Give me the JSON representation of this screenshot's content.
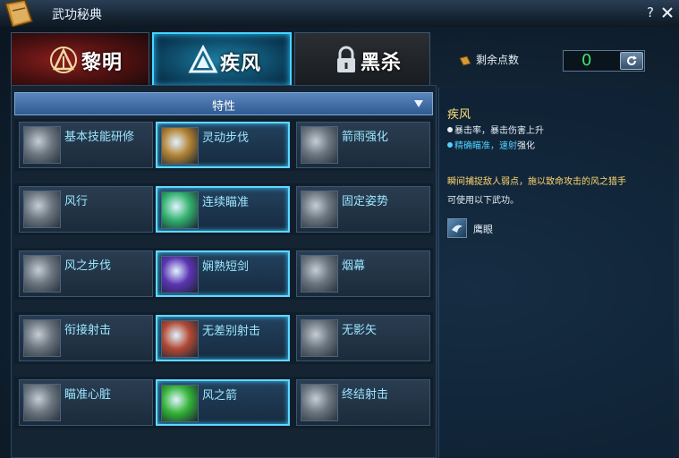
{
  "window": {
    "title": "武功秘典",
    "help_label": "?"
  },
  "tabs": [
    {
      "label": "黎明",
      "state": "inactive"
    },
    {
      "label": "疾风",
      "state": "active"
    },
    {
      "label": "黑杀",
      "state": "locked"
    }
  ],
  "points": {
    "label": "剩余点数",
    "value": "0"
  },
  "filter": {
    "selected": "特性"
  },
  "skills": [
    [
      {
        "name": "基本技能研修",
        "selected": false
      },
      {
        "name": "灵动步伐",
        "selected": true
      },
      {
        "name": "箭雨强化",
        "selected": false
      }
    ],
    [
      {
        "name": "风行",
        "selected": false
      },
      {
        "name": "连续瞄准",
        "selected": true
      },
      {
        "name": "固定姿势",
        "selected": false
      }
    ],
    [
      {
        "name": "风之步伐",
        "selected": false
      },
      {
        "name": "娴熟短剑",
        "selected": true
      },
      {
        "name": "烟幕",
        "selected": false
      }
    ],
    [
      {
        "name": "衔接射击",
        "selected": false
      },
      {
        "name": "无差别射击",
        "selected": true
      },
      {
        "name": "无影矢",
        "selected": false
      }
    ],
    [
      {
        "name": "瞄准心脏",
        "selected": false
      },
      {
        "name": "风之箭",
        "selected": true
      },
      {
        "name": "终结射击",
        "selected": false
      }
    ]
  ],
  "detail": {
    "title": "疾风",
    "line1": "暴击率，暴击伤害上升",
    "line2_a": "精确瞄准，速射",
    "line2_b": "强化",
    "description": "瞬间捕捉敌人弱点，施以致命攻击的风之猎手",
    "usable_text": "可使用以下武功。",
    "usable_skill": "鹰眼"
  },
  "colors": {
    "accent_cyan": "#5fd8ff",
    "points_green": "#3fe36e",
    "title_yellow": "#ffe07a"
  }
}
